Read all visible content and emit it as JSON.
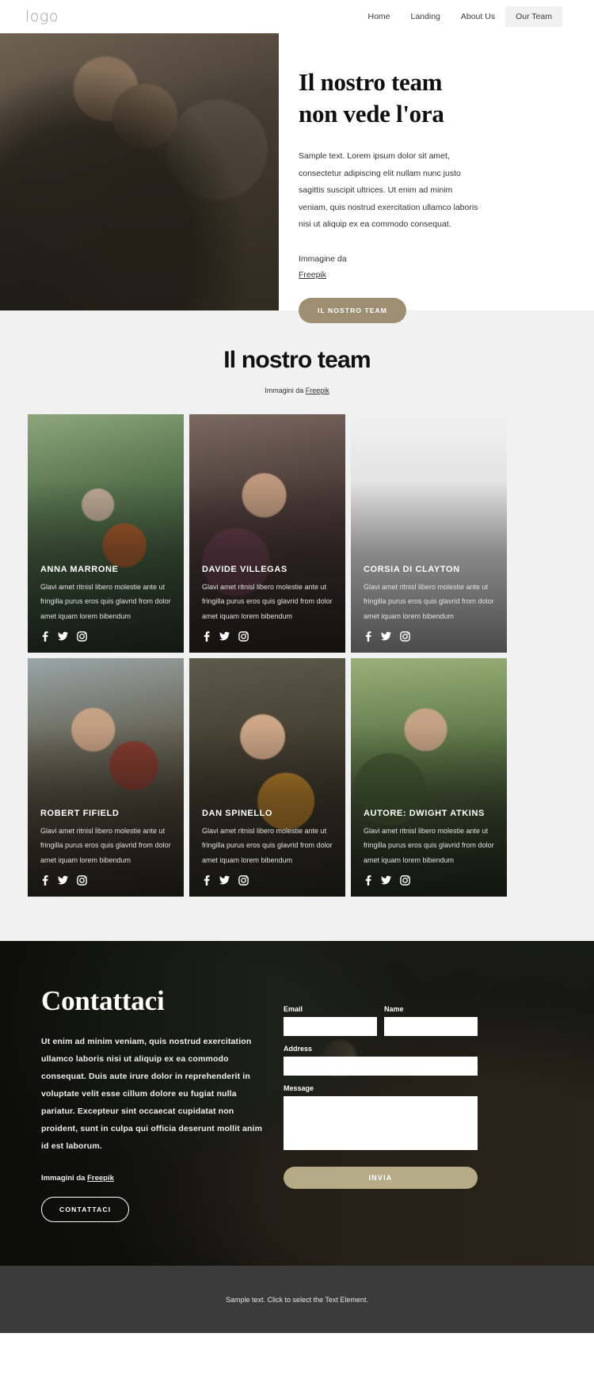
{
  "header": {
    "logo": "logo",
    "nav": [
      {
        "label": "Home",
        "active": false
      },
      {
        "label": "Landing",
        "active": false
      },
      {
        "label": "About Us",
        "active": false
      },
      {
        "label": "Our Team",
        "active": true
      }
    ]
  },
  "hero": {
    "title_line1": "Il nostro team",
    "title_line2": "non vede l'ora",
    "paragraph": "Sample text. Lorem ipsum dolor sit amet, consectetur adipiscing elit nullam nunc justo sagittis suscipit ultrices. Ut enim ad minim veniam, quis nostrud exercitation ullamco laboris nisi ut aliquip ex ea commodo consequat.",
    "credit_prefix": "Immagine da",
    "credit_link": "Freepik",
    "cta_label": "IL NOSTRO TEAM"
  },
  "team": {
    "title": "Il nostro team",
    "subtitle_prefix": "Immagini da ",
    "subtitle_link": "Freepik",
    "member_description": "Glavi amet ritnisl libero molestie ante ut fringilla purus eros quis glavrid from dolor amet iquam lorem bibendum",
    "members": [
      {
        "name": "ANNA MARRONE"
      },
      {
        "name": "DAVIDE VILLEGAS"
      },
      {
        "name": "CORSIA DI CLAYTON"
      },
      {
        "name": "ROBERT FIFIELD"
      },
      {
        "name": "DAN SPINELLO"
      },
      {
        "name": "AUTORE: DWIGHT ATKINS"
      }
    ],
    "social_icons": [
      "facebook-icon",
      "twitter-icon",
      "instagram-icon"
    ]
  },
  "contact": {
    "title": "Contattaci",
    "paragraph": "Ut enim ad minim veniam, quis nostrud exercitation ullamco laboris nisi ut aliquip ex ea commodo consequat. Duis aute irure dolor in reprehenderit in voluptate velit esse cillum dolore eu fugiat nulla pariatur. Excepteur sint occaecat cupidatat non proident, sunt in culpa qui officia deserunt mollit anim id est laborum.",
    "credit_prefix": "Immagini da ",
    "credit_link": "Freepik",
    "cta_label": "CONTATTACI",
    "form": {
      "email_label": "Email",
      "email_value": "",
      "name_label": "Name",
      "name_value": "",
      "address_label": "Address",
      "address_value": "",
      "message_label": "Message",
      "message_value": "",
      "submit_label": "INVIA"
    }
  },
  "footer": {
    "text": "Sample text. Click to select the Text Element."
  },
  "colors": {
    "accent_button": "#9f8f72",
    "submit_button": "#b6ab87",
    "team_bg": "#f1f1f1",
    "footer_bg": "#3b3b3b"
  }
}
